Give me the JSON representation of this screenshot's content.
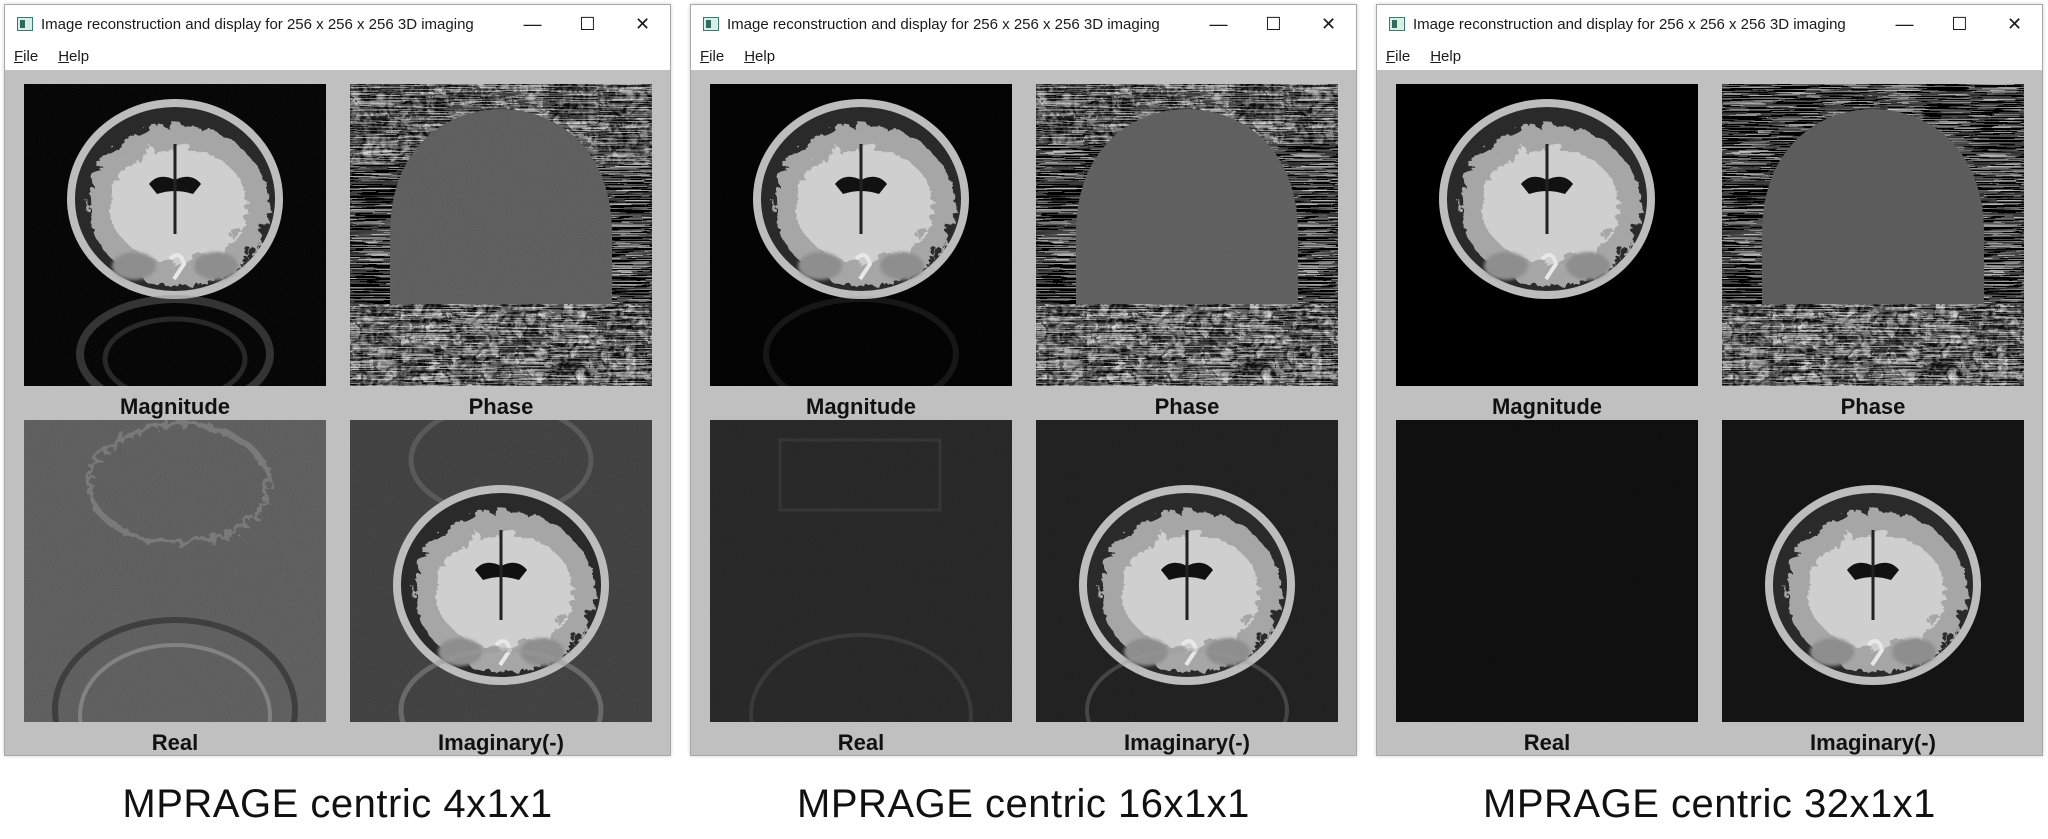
{
  "windows": [
    {
      "title": "Image reconstruction and display for 256 x 256 x 256 3D imaging",
      "menu": [
        {
          "key": "F",
          "rest": "ile"
        },
        {
          "key": "H",
          "rest": "elp"
        }
      ],
      "controls": {
        "minimize": "—",
        "maximize": "☐",
        "close": "✕"
      },
      "panels": [
        {
          "label": "Magnitude"
        },
        {
          "label": "Phase"
        },
        {
          "label": "Real"
        },
        {
          "label": "Imaginary(-)"
        }
      ],
      "caption": "MPRAGE centric 4x1x1"
    },
    {
      "title": "Image reconstruction and display for 256 x 256 x 256 3D imaging",
      "menu": [
        {
          "key": "F",
          "rest": "ile"
        },
        {
          "key": "H",
          "rest": "elp"
        }
      ],
      "controls": {
        "minimize": "—",
        "maximize": "☐",
        "close": "✕"
      },
      "panels": [
        {
          "label": "Magnitude"
        },
        {
          "label": "Phase"
        },
        {
          "label": "Real"
        },
        {
          "label": "Imaginary(-)"
        }
      ],
      "caption": "MPRAGE centric 16x1x1"
    },
    {
      "title": "Image reconstruction and display for 256 x 256 x 256 3D imaging",
      "menu": [
        {
          "key": "F",
          "rest": "ile"
        },
        {
          "key": "H",
          "rest": "elp"
        }
      ],
      "controls": {
        "minimize": "—",
        "maximize": "☐",
        "close": "✕"
      },
      "panels": [
        {
          "label": "Magnitude"
        },
        {
          "label": "Phase"
        },
        {
          "label": "Real"
        },
        {
          "label": "Imaginary(-)"
        }
      ],
      "caption": "MPRAGE centric 32x1x1"
    }
  ],
  "colors": {
    "window_bg": "#c0c0c0",
    "titlebar_bg": "#ffffff",
    "panel_bg": "#000000"
  }
}
